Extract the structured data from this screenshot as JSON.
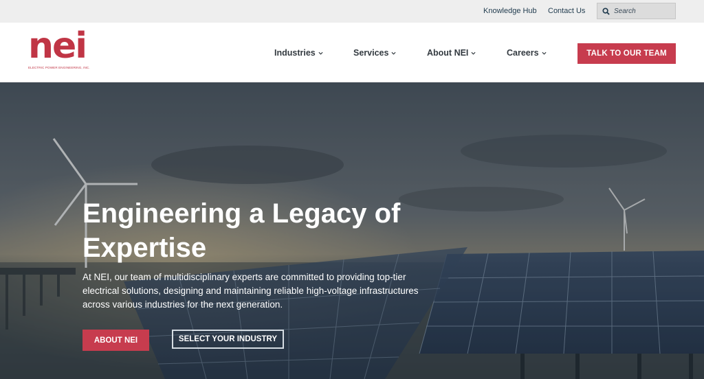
{
  "utility": {
    "knowledge_hub": "Knowledge Hub",
    "contact_us": "Contact Us",
    "search_placeholder": "Search"
  },
  "logo": {
    "wordmark": "nei",
    "tagline": "ELECTRIC POWER ENGINEERING, INC."
  },
  "nav": {
    "items": [
      {
        "label": "Industries"
      },
      {
        "label": "Services"
      },
      {
        "label": "About NEI"
      },
      {
        "label": "Careers"
      }
    ],
    "cta_label": "TALK TO OUR TEAM"
  },
  "hero": {
    "title": "Engineering a Legacy of Expertise",
    "text": "At NEI, our team of multidisciplinary experts are committed to providing top-tier electrical solutions, designing and maintaining reliable high-voltage infrastructures across various industries for the next generation.",
    "primary_button": "ABOUT NEI",
    "secondary_button": "SELECT YOUR INDUSTRY"
  },
  "colors": {
    "brand_red": "#c73c4e",
    "nav_text": "#333a40",
    "utility_text": "#1f3a4d"
  }
}
